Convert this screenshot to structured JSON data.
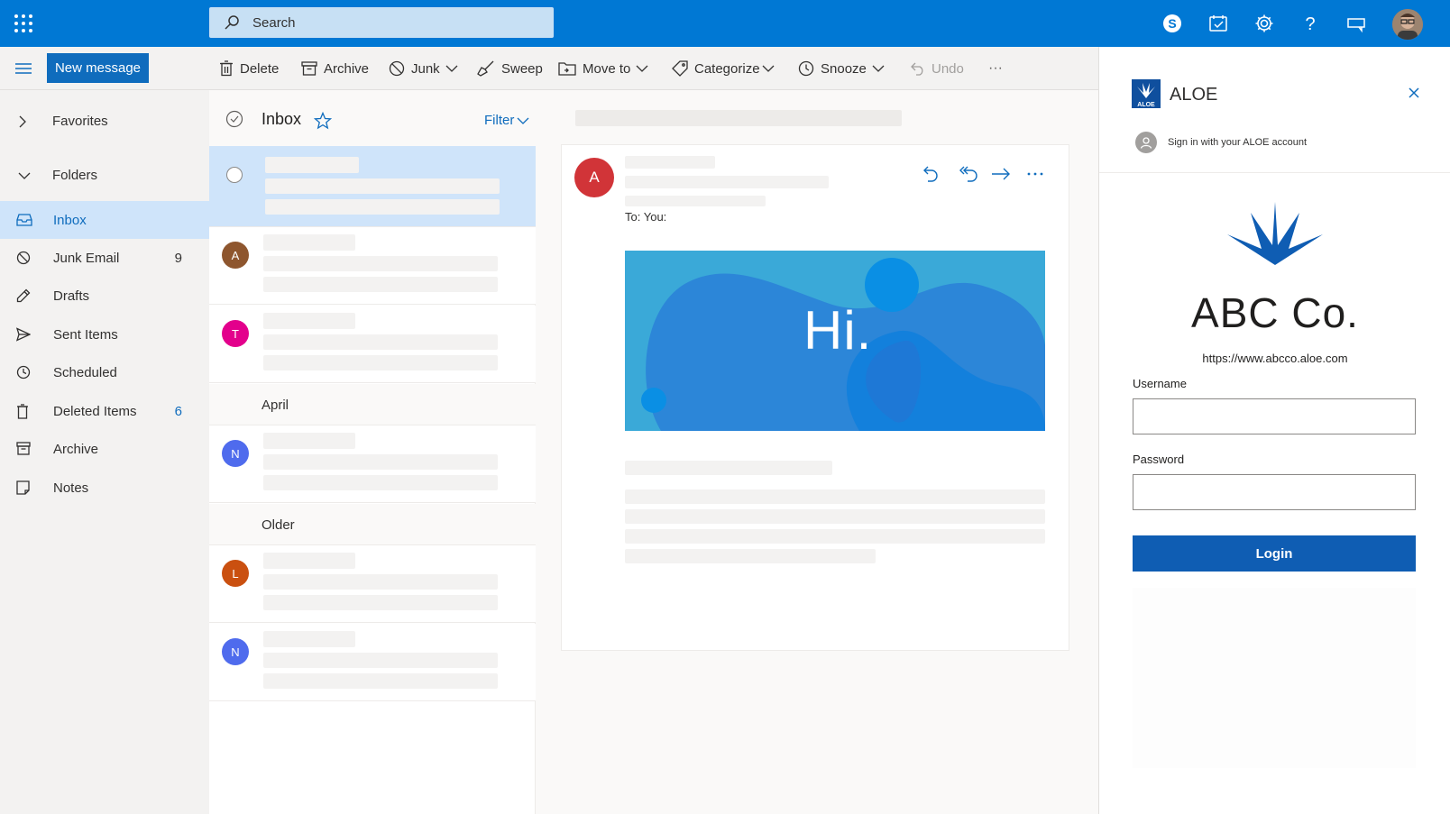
{
  "topbar": {
    "search_placeholder": "Search",
    "icons": [
      "app-launcher-icon",
      "skype-icon",
      "my-day-icon",
      "settings-icon",
      "help-icon",
      "feedback-icon",
      "profile-avatar"
    ]
  },
  "commands": {
    "new_message": "New message",
    "delete": "Delete",
    "archive": "Archive",
    "junk": "Junk",
    "sweep": "Sweep",
    "move_to": "Move to",
    "categorize": "Categorize",
    "snooze": "Snooze",
    "undo": "Undo",
    "more": "···"
  },
  "nav": {
    "favorites": "Favorites",
    "folders": "Folders",
    "items": [
      {
        "label": "Inbox",
        "count": ""
      },
      {
        "label": "Junk Email",
        "count": "9"
      },
      {
        "label": "Drafts",
        "count": ""
      },
      {
        "label": "Sent Items",
        "count": ""
      },
      {
        "label": "Scheduled",
        "count": ""
      },
      {
        "label": "Deleted Items",
        "count": "6"
      },
      {
        "label": "Archive",
        "count": ""
      },
      {
        "label": "Notes",
        "count": ""
      }
    ]
  },
  "list": {
    "title": "Inbox",
    "filter": "Filter",
    "groups": [
      "April",
      "Older"
    ],
    "avatars": [
      "A",
      "T",
      "N",
      "L",
      "N"
    ]
  },
  "reading": {
    "sender_initial": "A",
    "to_label": "To:",
    "to_value": "You:",
    "banner_text": "Hi."
  },
  "panel": {
    "brand": "ALOE",
    "logo_text": "ALOE",
    "signin_text": "Sign in with your ALOE account",
    "company": "ABC Co.",
    "url": "https://www.abcco.aloe.com",
    "username_label": "Username",
    "username_value": "",
    "password_label": "Password",
    "password_value": "",
    "login_label": "Login"
  },
  "colors": {
    "brand_blue": "#0078d4",
    "selection": "#cfe4fa",
    "login_button": "#0f5db3",
    "avatar_A": "#8e562e",
    "avatar_T": "#e3008c",
    "avatar_N": "#4f6bed",
    "avatar_L": "#ca5010",
    "sender_A": "#d13438"
  }
}
